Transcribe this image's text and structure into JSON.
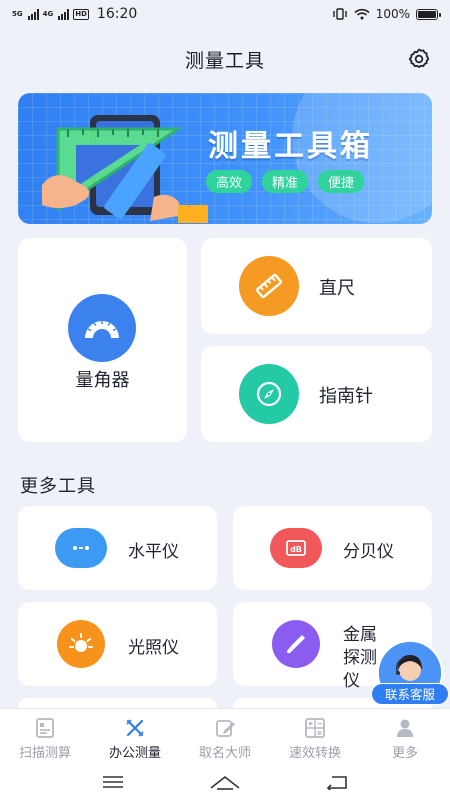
{
  "status_bar": {
    "net_a": "5G",
    "net_b": "4G",
    "hd": "HD",
    "time": "16:20",
    "battery": "100%",
    "battery_level": 1.0
  },
  "header": {
    "title": "测量工具",
    "settings_icon": "gear-icon"
  },
  "banner": {
    "title": "测量工具箱",
    "tags": [
      "高效",
      "精准",
      "便捷"
    ],
    "colors": {
      "background": "#3f91fb",
      "tag": "#2fd39b"
    }
  },
  "main_tools": {
    "protractor": {
      "label": "量角器",
      "icon": "protractor-icon",
      "color": "#3c82ee"
    },
    "ruler": {
      "label": "直尺",
      "icon": "ruler-icon",
      "color": "#f59a22"
    },
    "compass": {
      "label": "指南针",
      "icon": "compass-icon",
      "color": "#24c9a5"
    }
  },
  "more_tools": {
    "title": "更多工具",
    "items": [
      {
        "label": "水平仪",
        "icon": "level-icon",
        "color": "#3d9af3"
      },
      {
        "label": "分贝仪",
        "icon": "decibel-icon",
        "color": "#f0585a"
      },
      {
        "label": "光照仪",
        "icon": "sun-icon",
        "color": "#f7931c"
      },
      {
        "label": "金属探测仪",
        "icon": "metal-detector-icon",
        "color": "#8a5cf0"
      }
    ]
  },
  "customer_service": {
    "label": "联系客服"
  },
  "tab_bar": {
    "tabs": [
      {
        "label": "扫描测算",
        "icon": "scan-icon",
        "active": false
      },
      {
        "label": "办公测量",
        "icon": "measure-icon",
        "active": true
      },
      {
        "label": "取名大师",
        "icon": "pen-icon",
        "active": false
      },
      {
        "label": "速效转换",
        "icon": "calculator-icon",
        "active": false
      },
      {
        "label": "更多",
        "icon": "user-icon",
        "active": false
      }
    ]
  }
}
